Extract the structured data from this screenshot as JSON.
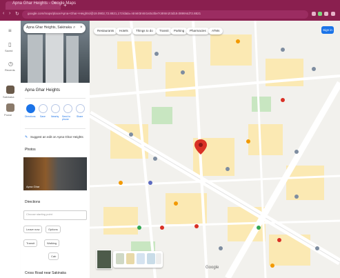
{
  "browser": {
    "tab_title": "Apna Ghar Heights - Google Maps",
    "new_tab": "+",
    "tab_close": "×",
    "url": "google.com/maps/place/Apna+Ghar+Heights/@19.0902,72.8821,17z/data=!4m6!3m5!1s0x3be7c8!8m2!3d19.0899!4d72.8821"
  },
  "rail": {
    "menu_icon": "menu-icon",
    "items": [
      {
        "label": "Saved",
        "icon": "bookmark-icon"
      },
      {
        "label": "Recents",
        "icon": "history-icon"
      },
      {
        "label": "Sakinaka",
        "icon": "place-thumb"
      },
      {
        "label": "Powai",
        "icon": "place-thumb"
      }
    ]
  },
  "panel": {
    "search_value": "Apna Ghar Heights, Sakinaka",
    "place_name": "Apna Ghar Heights",
    "actions": [
      {
        "label": "Directions",
        "primary": true
      },
      {
        "label": "Save"
      },
      {
        "label": "Nearby"
      },
      {
        "label": "Send to phone"
      },
      {
        "label": "Share"
      }
    ],
    "suggest_edit": "Suggest an edit on Apna Ghar Heights",
    "photos_label": "Photos",
    "photo_caption": "Apna Ghar",
    "directions_label": "Directions",
    "directions_placeholder": "Choose starting point",
    "chips": [
      "Leave now",
      "Options",
      "Transit",
      "Walking",
      "Cab"
    ],
    "footer_label": "Cross Road near Sakinaka"
  },
  "map": {
    "filters": [
      "Restaurants",
      "Hotels",
      "Things to do",
      "Transit",
      "Parking",
      "Pharmacies",
      "ATMs"
    ],
    "signin": "Sign in",
    "google": "Google",
    "colors": {
      "pin": "#d93025",
      "road": "#ffffff",
      "block": "#fbe9b3",
      "park": "#c8e6c1",
      "accent": "#1a73e8"
    }
  }
}
